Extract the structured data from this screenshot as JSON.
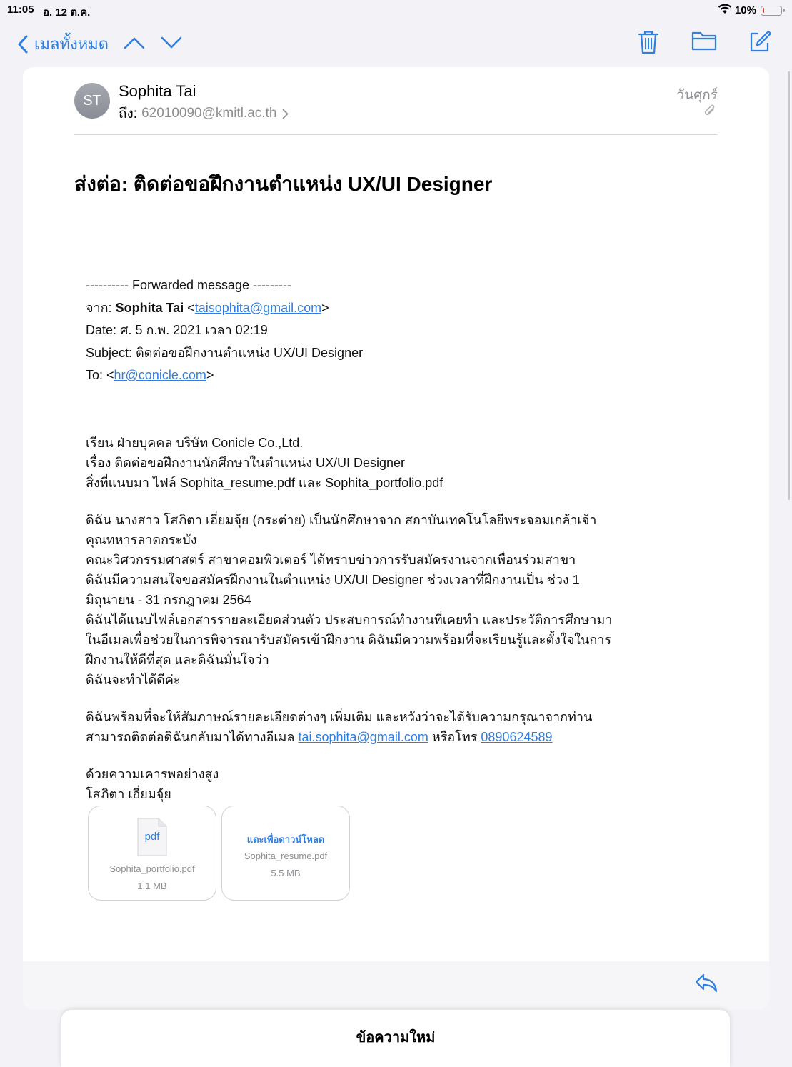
{
  "status": {
    "time": "11:05",
    "date": "อ. 12 ต.ค.",
    "battery": "10%",
    "battery_level": 0.1
  },
  "toolbar": {
    "back_label": "เมลทั้งหมด",
    "accent_color": "#2f7ee0"
  },
  "email": {
    "avatar_initials": "ST",
    "sender": "Sophita Tai",
    "to_label": "ถึง:",
    "to_address": "62010090@kmitl.ac.th",
    "date": "วันศุกร์",
    "subject": "ส่งต่อ: ติดต่อขอฝึกงานตำแหน่ง UX/UI Designer",
    "forward": {
      "header": "---------- Forwarded message ---------",
      "from_label": "จาก:",
      "from_name": "Sophita Tai",
      "from_email": "taisophita@gmail.com",
      "date_line": "Date: ศ. 5 ก.พ. 2021 เวลา 02:19",
      "subject_line": "Subject: ติดต่อขอฝึกงานตำแหน่ง UX/UI Designer",
      "to_label": "To:",
      "to_email": "hr@conicle.com"
    },
    "body": {
      "greeting_lines": [
        "เรียน ฝ่ายบุคคล บริษัท Conicle Co.,Ltd.",
        "เรื่อง ติดต่อขอฝึกงานนักศึกษาในตำแหน่ง UX/UI Designer",
        "สิ่งที่แนบมา ไฟล์ Sophita_resume.pdf และ Sophita_portfolio.pdf"
      ],
      "paragraph_lines": [
        "ดิฉัน นางสาว โสภิตา  เอี่ยมจุ้ย (กระต่าย) เป็นนักศึกษาจาก สถาบันเทคโนโลยีพระจอมเกล้าเจ้า",
        "คุณทหารลาดกระบัง",
        "คณะวิศวกรรมศาสตร์ สาขาคอมพิวเตอร์ ได้ทราบข่าวการรับสมัครงานจากเพื่อนร่วมสาขา",
        "ดิฉันมีความสนใจขอสมัครฝึกงานในตำแหน่ง UX/UI Designer ช่วงเวลาที่ฝึกงานเป็น ช่วง 1",
        "มิถุนายน - 31 กรกฎาคม 2564",
        "ดิฉันได้แนบไฟล์เอกสารรายละเอียดส่วนตัว ประสบการณ์ทำงานที่เคยทำ และประวัติการศึกษามา",
        "ในอีเมลเพื่อช่วยในการพิจารณารับสมัครเข้าฝึกงาน ดิฉันมีความพร้อมที่จะเรียนรู้และตั้งใจในการ",
        "ฝึกงานให้ดีที่สุด และดิฉันมั่นใจว่า",
        "ดิฉันจะทำได้ดีค่ะ"
      ],
      "contact_line1": "ดิฉันพร้อมที่จะให้สัมภาษณ์รายละเอียดต่างๆ เพิ่มเติม และหวังว่าจะได้รับความกรุณาจากท่าน",
      "contact_prefix": "สามารถติดต่อดิฉันกลับมาได้ทางอีเมล",
      "contact_email": "tai.sophita@gmail.com",
      "contact_mid": "หรือโทร",
      "contact_phone": "0890624589",
      "closing": "ด้วยความเคารพอย่างสูง",
      "signature": "โสภิตา  เอี่ยมจุ้ย"
    },
    "attachments": [
      {
        "icon_label": "pdf",
        "name": "Sophita_portfolio.pdf",
        "size": "1.1 MB"
      },
      {
        "action": "แตะเพื่อดาวน์โหลด",
        "name": "Sophita_resume.pdf",
        "size": "5.5 MB"
      }
    ]
  },
  "draft_bar": {
    "label": "ข้อความใหม่"
  }
}
